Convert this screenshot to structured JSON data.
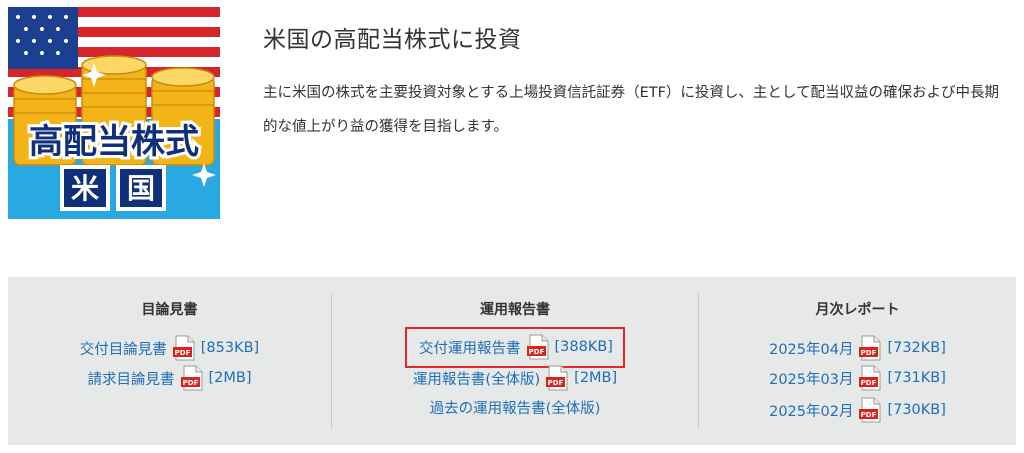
{
  "fund": {
    "title": "米国の高配当株式に投資",
    "description": "主に米国の株式を主要投資対象とする上場投資信託証券（ETF）に投資し、主として配当収益の確保および中長期的な値上がり益の獲得を目指します。",
    "image": {
      "banner_text": "高配当株式",
      "label_chars": [
        "米",
        "国"
      ]
    }
  },
  "documents": {
    "prospectus": {
      "heading": "目論見書",
      "links": [
        {
          "label": "交付目論見書",
          "size": "[853KB]"
        },
        {
          "label": "請求目論見書",
          "size": "[2MB]"
        }
      ]
    },
    "reports": {
      "heading": "運用報告書",
      "links": [
        {
          "label": "交付運用報告書",
          "size": "[388KB]",
          "highlighted": true
        },
        {
          "label": "運用報告書(全体版)",
          "size": "[2MB]"
        },
        {
          "label": "過去の運用報告書(全体版)",
          "size": ""
        }
      ]
    },
    "monthly": {
      "heading": "月次レポート",
      "links": [
        {
          "label": "2025年04月",
          "size": "[732KB]"
        },
        {
          "label": "2025年03月",
          "size": "[731KB]"
        },
        {
          "label": "2025年02月",
          "size": "[730KB]"
        }
      ]
    }
  },
  "icons": {
    "pdf": "pdf-icon",
    "pdf_text": "PDF"
  },
  "colors": {
    "link": "#1e6fb8",
    "highlight_border": "#e8252b",
    "panel_bg": "#e7e8e8",
    "pdf_red": "#d9241c"
  }
}
